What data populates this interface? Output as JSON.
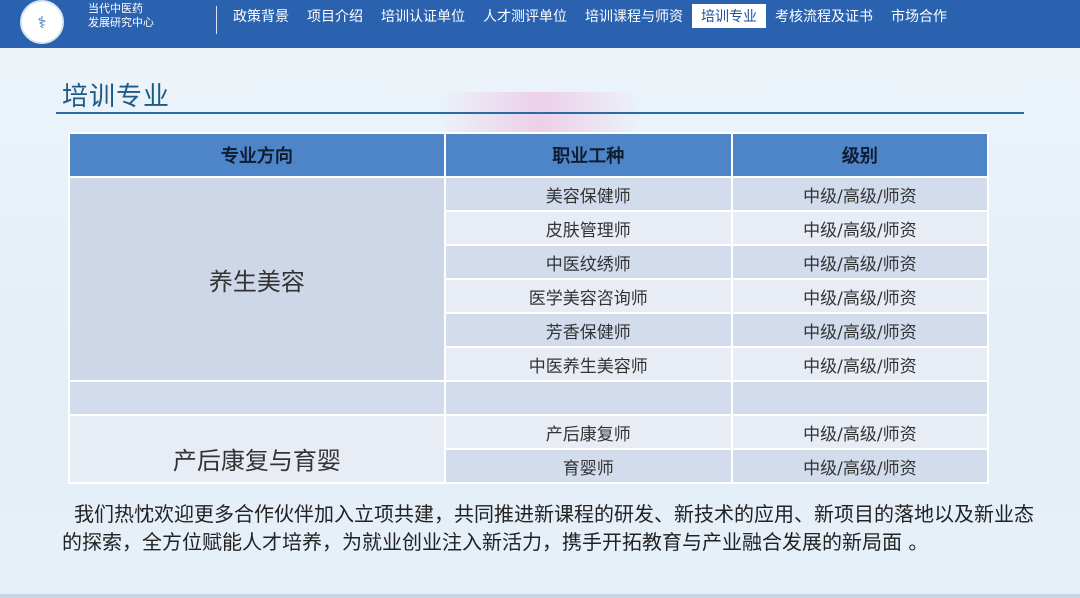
{
  "header": {
    "org_line1": "当代中医药",
    "org_line2": "发展研究中心",
    "nav": [
      "政策背景",
      "项目介绍",
      "培训认证单位",
      "人才测评单位",
      "培训课程与师资",
      "培训专业",
      "考核流程及证书",
      "市场合作"
    ],
    "active_nav": "培训专业"
  },
  "page": {
    "title": "培训专业"
  },
  "table": {
    "headers": [
      "专业方向",
      "职业工种",
      "级别"
    ],
    "group1": {
      "direction": "养生美容",
      "rows": [
        {
          "job": "美容保健师",
          "level": "中级/高级/师资"
        },
        {
          "job": "皮肤管理师",
          "level": "中级/高级/师资"
        },
        {
          "job": "中医纹绣师",
          "level": "中级/高级/师资"
        },
        {
          "job": "医学美容咨询师",
          "level": "中级/高级/师资"
        },
        {
          "job": "芳香保健师",
          "level": "中级/高级/师资"
        },
        {
          "job": "中医养生美容师",
          "level": "中级/高级/师资"
        }
      ]
    },
    "group2": {
      "direction": "产后康复与育婴",
      "rows": [
        {
          "job": "产后康复师",
          "level": "中级/高级/师资"
        },
        {
          "job": "育婴师",
          "level": "中级/高级/师资"
        }
      ]
    }
  },
  "paragraph": "我们热忱欢迎更多合作伙伴加入立项共建，共同推进新课程的研发、新技术的应用、新项目的落地以及新业态的探索，全方位赋能人才培养，为就业创业注入新活力，携手开拓教育与产业融合发展的新局面 。"
}
